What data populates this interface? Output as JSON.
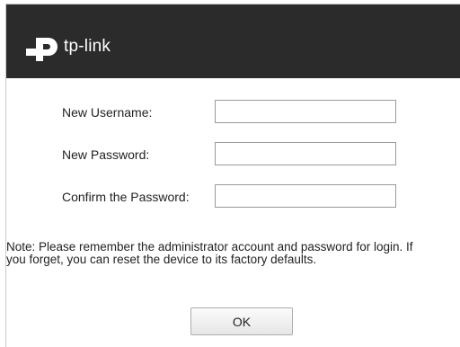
{
  "header": {
    "brand": "tp-link",
    "background_color": "#2b2b2b",
    "logo_icon": "tp-link-logo-icon"
  },
  "form": {
    "username": {
      "label": "New Username:",
      "value": ""
    },
    "password": {
      "label": "New Password:",
      "value": ""
    },
    "confirm": {
      "label": "Confirm the Password:",
      "value": ""
    }
  },
  "note": "Note: Please remember the administrator account and password for login. If you forget, you can reset the device to its factory defaults.",
  "buttons": {
    "ok_label": "OK"
  }
}
